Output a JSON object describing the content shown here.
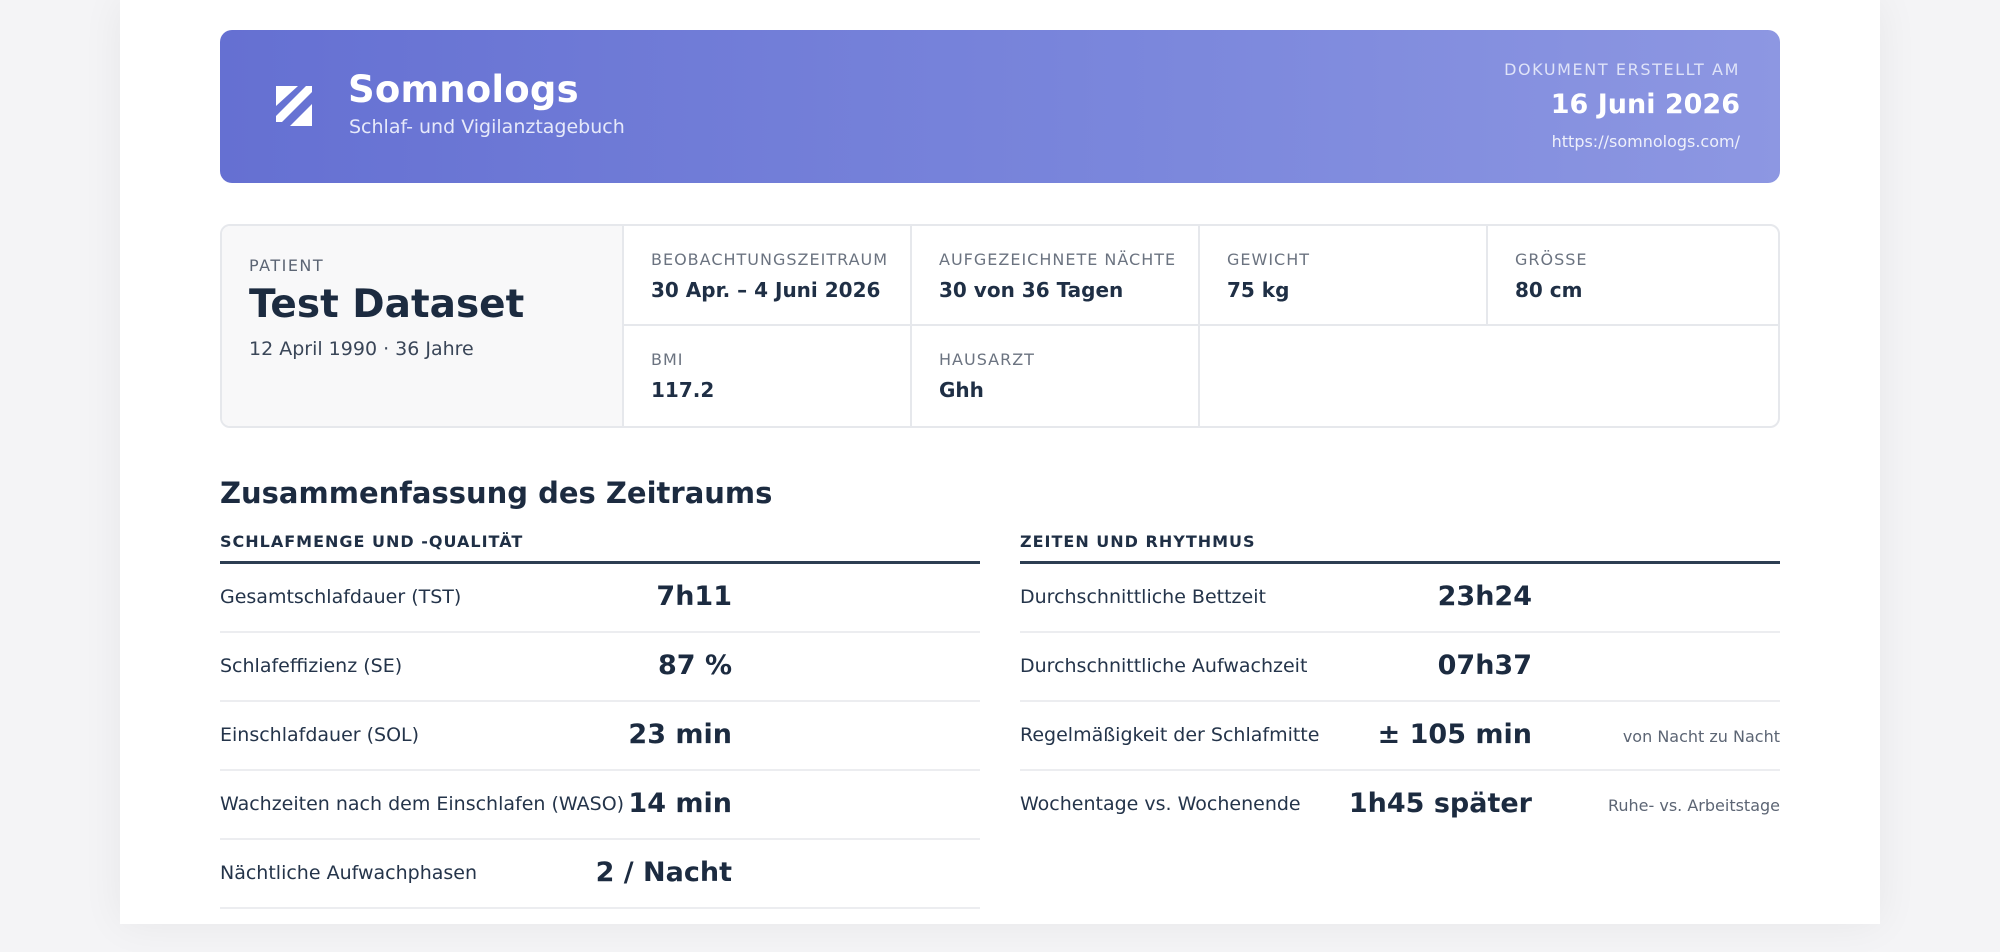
{
  "header": {
    "brand": "Somnologs",
    "subtitle": "Schlaf- und Vigilanztagebuch",
    "doc_label": "DOKUMENT ERSTELLT AM",
    "doc_date": "16 Juni 2026",
    "url": "https://somnologs.com/"
  },
  "patient": {
    "label": "PATIENT",
    "name": "Test Dataset",
    "dob": "12 April 1990 · 36 Jahre",
    "fields": [
      {
        "label": "BEOBACHTUNGSZEITRAUM",
        "value": "30 Apr. – 4 Juni 2026"
      },
      {
        "label": "AUFGEZEICHNETE NÄCHTE",
        "value": "30 von 36 Tagen"
      },
      {
        "label": "GEWICHT",
        "value": "75 kg"
      },
      {
        "label": "GRÖSSE",
        "value": "80 cm"
      },
      {
        "label": "BMI",
        "value": "117.2"
      },
      {
        "label": "HAUSARZT",
        "value": "Ghh"
      }
    ]
  },
  "summary": {
    "title": "Zusammenfassung des Zeitraums",
    "left": {
      "heading": "SCHLAFMENGE UND -QUALITÄT",
      "rows": [
        {
          "label": "Gesamtschlafdauer (TST)",
          "value": "7h11"
        },
        {
          "label": "Schlafeffizienz (SE)",
          "value": "87 %"
        },
        {
          "label": "Einschlafdauer (SOL)",
          "value": "23 min"
        },
        {
          "label": "Wachzeiten nach dem Einschlafen (WASO)",
          "value": "14 min"
        },
        {
          "label": "Nächtliche Aufwachphasen",
          "value": "2 / Nacht"
        }
      ]
    },
    "right": {
      "heading": "ZEITEN UND RHYTHMUS",
      "rows": [
        {
          "label": "Durchschnittliche Bettzeit",
          "value": "23h24",
          "note": ""
        },
        {
          "label": "Durchschnittliche Aufwachzeit",
          "value": "07h37",
          "note": ""
        },
        {
          "label": "Regelmäßigkeit der Schlafmitte",
          "value": "± 105 min",
          "note": "von Nacht zu Nacht"
        },
        {
          "label": "Wochentage vs. Wochenende",
          "value": "1h45 später",
          "note": "Ruhe- vs. Arbeitstage"
        }
      ]
    }
  }
}
